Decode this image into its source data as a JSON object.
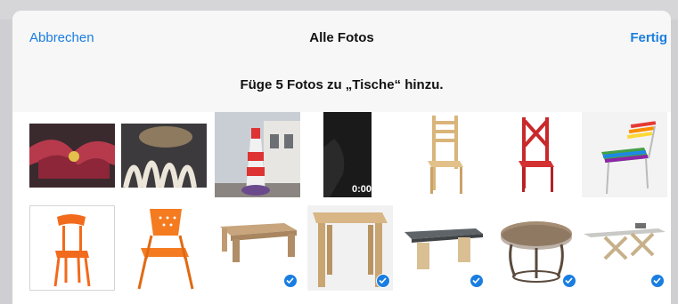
{
  "nav": {
    "cancel_label": "Abbrechen",
    "title": "Alle Fotos",
    "done_label": "Fertig"
  },
  "prompt": "Füge 5 Fotos zu „Tische“ hinzu.",
  "accent_color": "#1a7ee0",
  "photos": [
    {
      "subject": "red-flower-closeup",
      "selected": false
    },
    {
      "subject": "white-flower-closeup",
      "selected": false
    },
    {
      "subject": "lighthouse-inflatable",
      "selected": false
    },
    {
      "subject": "dark-video",
      "selected": false,
      "duration": "0:00"
    },
    {
      "subject": "wooden-chair",
      "selected": false
    },
    {
      "subject": "red-chair",
      "selected": false
    },
    {
      "subject": "rainbow-chair",
      "selected": false
    },
    {
      "subject": "orange-chair",
      "selected": false
    },
    {
      "subject": "orange-perforated-chair",
      "selected": false
    },
    {
      "subject": "wooden-low-table",
      "selected": true
    },
    {
      "subject": "wooden-square-table",
      "selected": true
    },
    {
      "subject": "gray-top-table",
      "selected": true
    },
    {
      "subject": "round-wooden-table",
      "selected": true
    },
    {
      "subject": "x-leg-table",
      "selected": true
    }
  ]
}
